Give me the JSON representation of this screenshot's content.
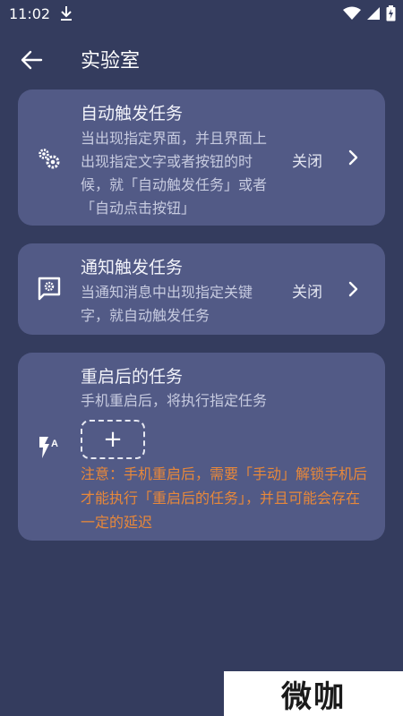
{
  "status_bar": {
    "time": "11:02",
    "icons": [
      "download-icon",
      "wifi-icon",
      "signal-icon",
      "battery-icon"
    ]
  },
  "app_bar": {
    "title": "实验室",
    "back_icon": "arrow-left-icon"
  },
  "cards": [
    {
      "icon": "gears-icon",
      "title": "自动触发任务",
      "description": "当出现指定界面，并且界面上出现指定文字或者按钮的时候，就「自动触发任务」或者「自动点击按钮」",
      "status": "关闭"
    },
    {
      "icon": "notification-gear-icon",
      "title": "通知触发任务",
      "description": "当通知消息中出现指定关键字，就自动触发任务",
      "status": "关闭"
    },
    {
      "icon": "flash-auto-icon",
      "title": "重启后的任务",
      "description": "手机重启后，将执行指定任务",
      "add_label": "+",
      "note": "注意：手机重启后，需要「手动」解锁手机后才能执行「重启后的任务」，并且可能会存在一定的延迟"
    }
  ],
  "watermark": {
    "text": "微咖"
  },
  "colors": {
    "background": "#343c5e",
    "card": "#525a86",
    "note": "#e8883a"
  }
}
